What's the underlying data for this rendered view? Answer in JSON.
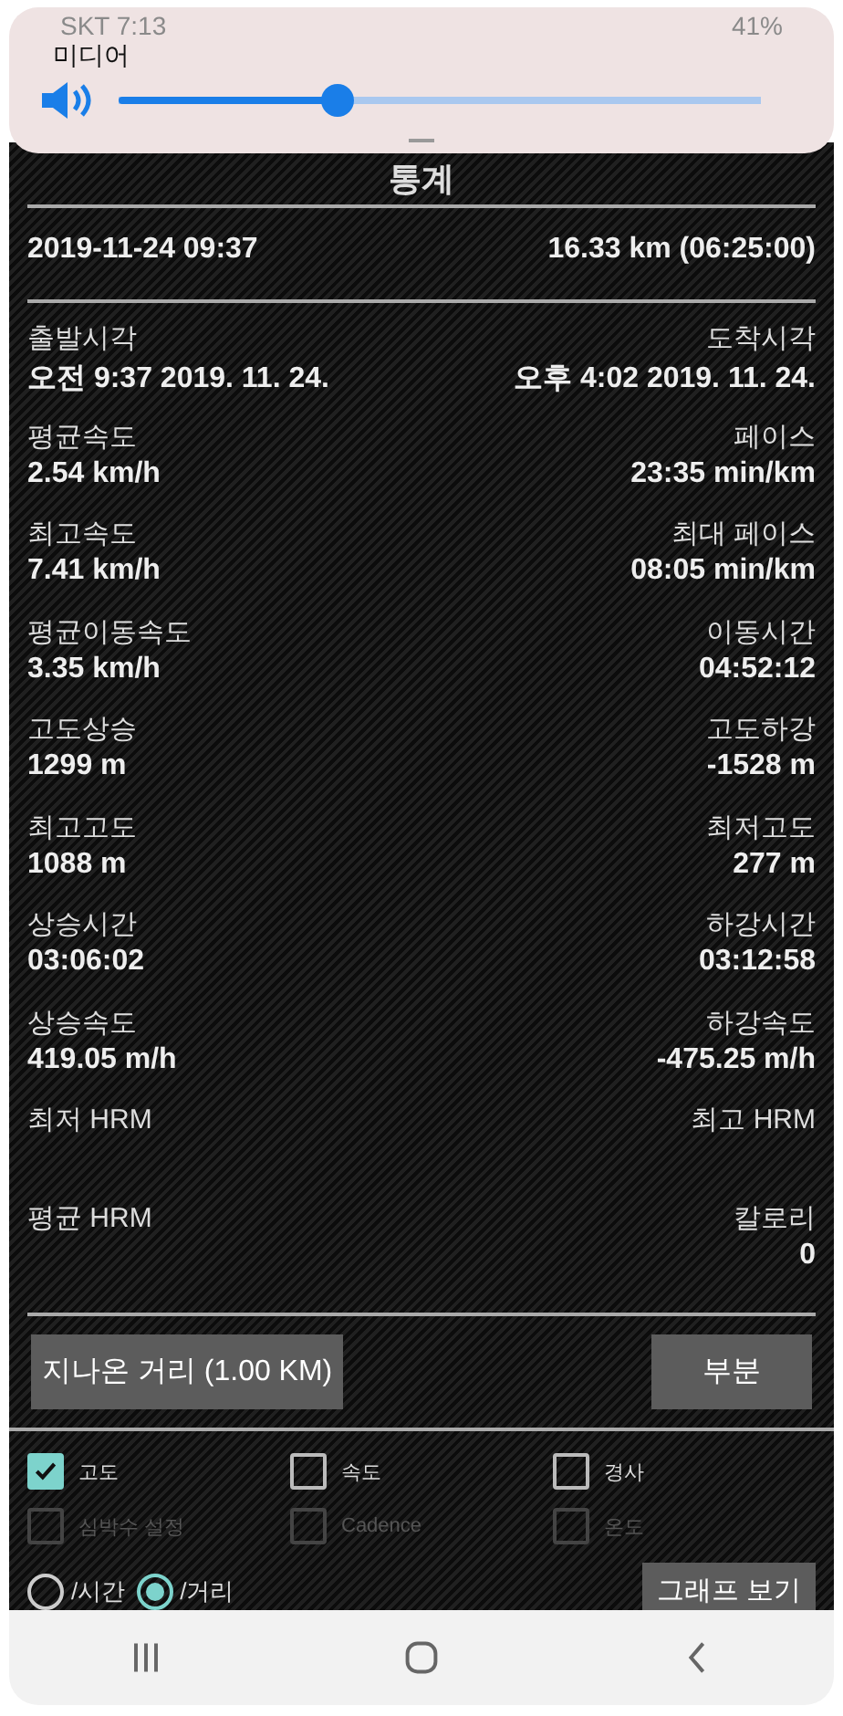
{
  "status_bar": {
    "carrier_time": "SKT 7:13",
    "battery": "41%"
  },
  "volume_panel": {
    "label": "미디어",
    "level": 0.34
  },
  "title": "통계",
  "summary": {
    "date": "2019-11-24 09:37",
    "distance": "16.33 km (06:25:00)"
  },
  "stats": [
    {
      "left_label": "출발시각",
      "left_value": "오전 9:37 2019. 11. 24.",
      "right_label": "도착시각",
      "right_value": "오후 4:02 2019. 11. 24."
    },
    {
      "left_label": "평균속도",
      "left_value": "2.54 km/h",
      "right_label": "페이스",
      "right_value": "23:35 min/km"
    },
    {
      "left_label": "최고속도",
      "left_value": "7.41 km/h",
      "right_label": "최대 페이스",
      "right_value": "08:05 min/km"
    },
    {
      "left_label": "평균이동속도",
      "left_value": "3.35 km/h",
      "right_label": "이동시간",
      "right_value": "04:52:12"
    },
    {
      "left_label": "고도상승",
      "left_value": "1299 m",
      "right_label": "고도하강",
      "right_value": "-1528 m"
    },
    {
      "left_label": "최고고도",
      "left_value": "1088 m",
      "right_label": "최저고도",
      "right_value": "277 m"
    },
    {
      "left_label": "상승시간",
      "left_value": "03:06:02",
      "right_label": "하강시간",
      "right_value": "03:12:58"
    },
    {
      "left_label": "상승속도",
      "left_value": "419.05 m/h",
      "right_label": "하강속도",
      "right_value": "-475.25 m/h"
    },
    {
      "left_label": "최저 HRM",
      "right_label": "최고 HRM"
    },
    {
      "left_label": "평균 HRM",
      "right_label": "칼로리",
      "right_value": "0"
    }
  ],
  "buttons": {
    "distance": "지나온 거리 (1.00  KM)",
    "segment": "부분"
  },
  "checkboxes": [
    {
      "label": "고도",
      "checked": true,
      "disabled": false
    },
    {
      "label": "속도",
      "checked": false,
      "disabled": false
    },
    {
      "label": "경사",
      "checked": false,
      "disabled": false
    },
    {
      "label": "심박수 설정",
      "checked": false,
      "disabled": true
    },
    {
      "label": "Cadence",
      "checked": false,
      "disabled": true
    },
    {
      "label": "온도",
      "checked": false,
      "disabled": true
    }
  ],
  "radios": [
    {
      "label": "/시간",
      "selected": false
    },
    {
      "label": "/거리",
      "selected": true
    }
  ],
  "graph_button": "그래프 보기"
}
